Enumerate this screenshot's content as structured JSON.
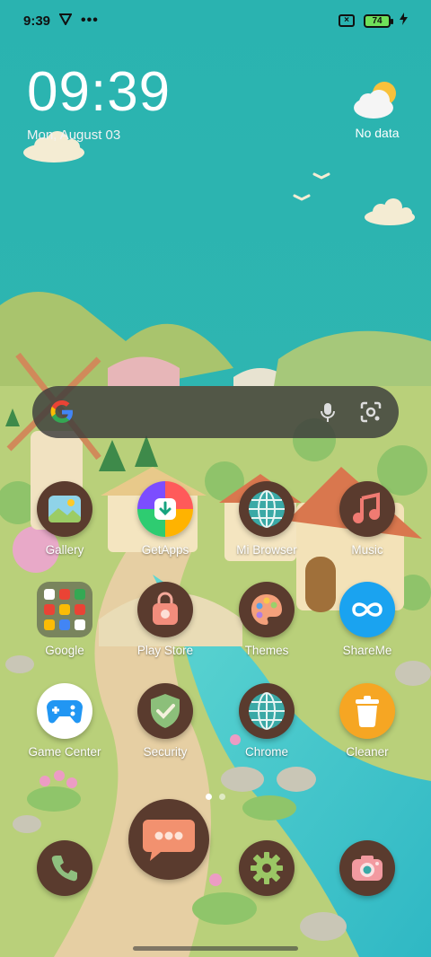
{
  "status_bar": {
    "time": "9:39",
    "battery_level": "74",
    "icons": [
      "vpn-icon",
      "more-icon",
      "sim-off-icon",
      "battery-icon",
      "charging-icon"
    ]
  },
  "clock": {
    "time": "09:39",
    "date": "Mon, August 03"
  },
  "weather": {
    "label": "No data",
    "icon": "partly-cloudy-icon"
  },
  "search": {
    "icons": [
      "google-logo",
      "mic-icon",
      "lens-icon"
    ]
  },
  "apps_row1": [
    {
      "label": "Gallery"
    },
    {
      "label": "GetApps"
    },
    {
      "label": "Mi Browser"
    },
    {
      "label": "Music"
    }
  ],
  "apps_row2": [
    {
      "label": "Google"
    },
    {
      "label": "Play Store"
    },
    {
      "label": "Themes"
    },
    {
      "label": "ShareMe"
    }
  ],
  "apps_row3": [
    {
      "label": "Game Center"
    },
    {
      "label": "Security"
    },
    {
      "label": "Chrome"
    },
    {
      "label": "Cleaner"
    }
  ],
  "dock": [
    "phone-icon",
    "messages-icon",
    "settings-icon",
    "camera-icon"
  ],
  "colors": {
    "sky": "#2bb0ad",
    "grass": "#b8cf7a",
    "icon_brown": "#5a3b2e",
    "shareme_blue": "#1aa3f0",
    "cleaner_orange": "#f6a623"
  }
}
